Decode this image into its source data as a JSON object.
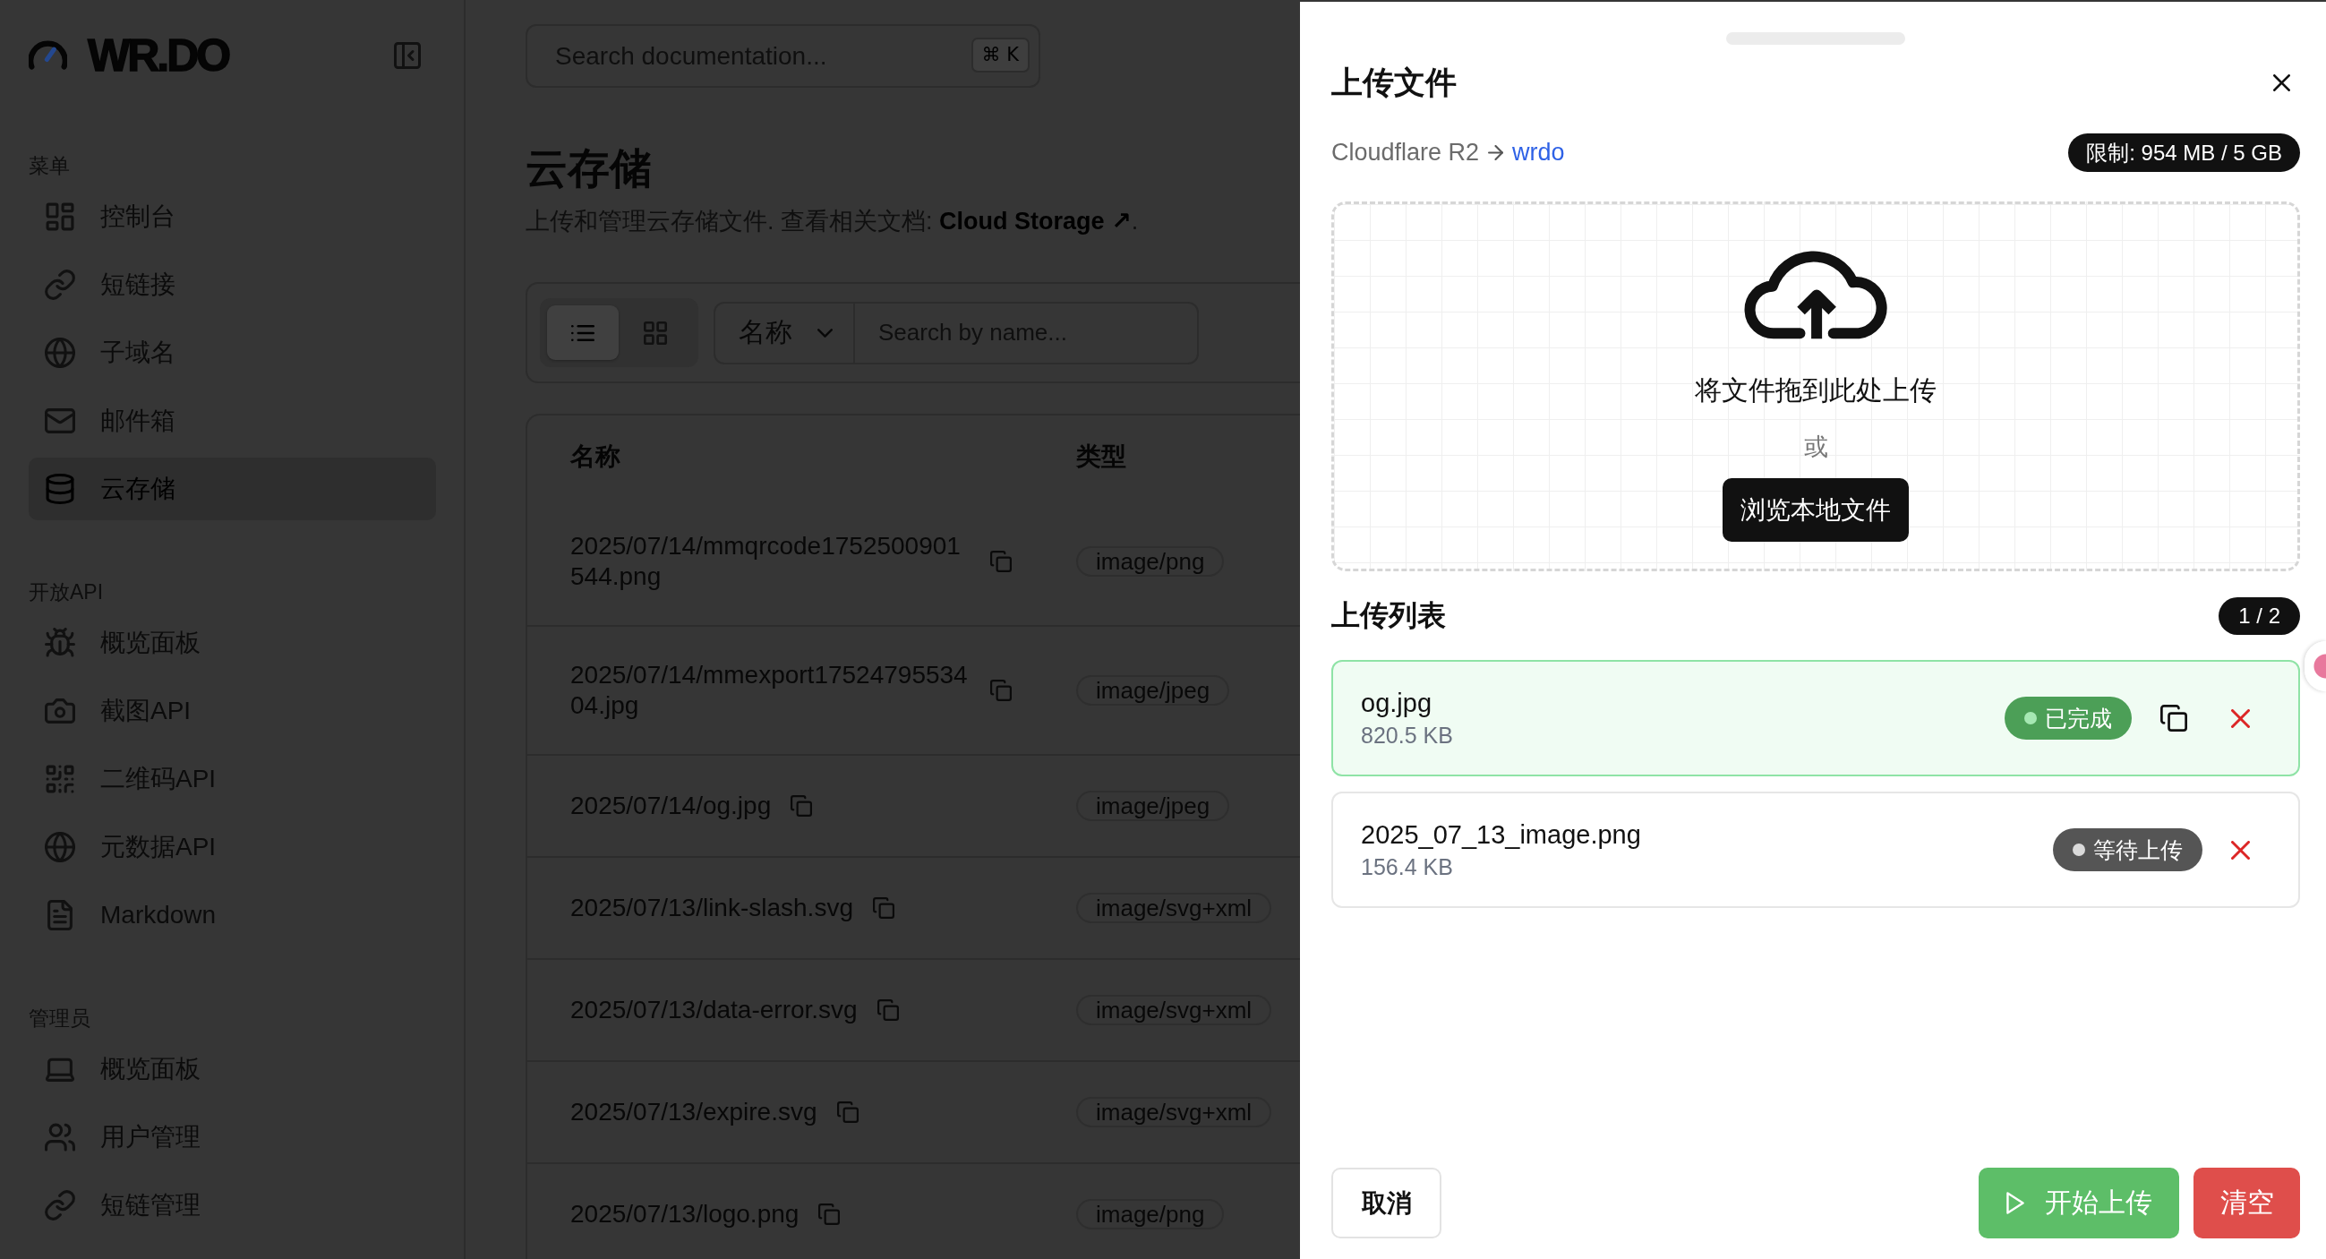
{
  "sidebar": {
    "logo": "WR.DO",
    "sections": [
      {
        "title": "菜单",
        "items": [
          {
            "label": "控制台",
            "selected": false
          },
          {
            "label": "短链接",
            "selected": false
          },
          {
            "label": "子域名",
            "selected": false
          },
          {
            "label": "邮件箱",
            "selected": false
          },
          {
            "label": "云存储",
            "selected": true
          }
        ]
      },
      {
        "title": "开放API",
        "items": [
          {
            "label": "概览面板",
            "selected": false
          },
          {
            "label": "截图API",
            "selected": false
          },
          {
            "label": "二维码API",
            "selected": false
          },
          {
            "label": "元数据API",
            "selected": false
          },
          {
            "label": "Markdown",
            "selected": false
          }
        ]
      },
      {
        "title": "管理员",
        "items": [
          {
            "label": "概览面板",
            "selected": false
          },
          {
            "label": "用户管理",
            "selected": false
          },
          {
            "label": "短链管理",
            "selected": false
          }
        ]
      }
    ]
  },
  "search": {
    "placeholder": "Search documentation...",
    "shortcut": "⌘ K"
  },
  "header": {
    "title": "云存储",
    "description": "上传和管理云存储文件. 查看相关文档:",
    "link": "Cloud Storage ↗",
    "description_end": "."
  },
  "toolbar": {
    "views": [
      {
        "kind": "list",
        "selected": true
      },
      {
        "kind": "grid",
        "selected": false
      }
    ],
    "sort": "名称",
    "search_placeholder": "Search by name..."
  },
  "table": {
    "columns": [
      "名称",
      "类型"
    ],
    "rows": [
      {
        "name": "2025/07/14/mmqrcode1752500901544.png",
        "type": "image/png"
      },
      {
        "name": "2025/07/14/mmexport1752479553404.jpg",
        "type": "image/jpeg"
      },
      {
        "name": "2025/07/14/og.jpg",
        "type": "image/jpeg"
      },
      {
        "name": "2025/07/13/link-slash.svg",
        "type": "image/svg+xml"
      },
      {
        "name": "2025/07/13/data-error.svg",
        "type": "image/svg+xml"
      },
      {
        "name": "2025/07/13/expire.svg",
        "type": "image/svg+xml"
      },
      {
        "name": "2025/07/13/logo.png",
        "type": "image/png"
      }
    ]
  },
  "upload_drawer": {
    "title": "上传文件",
    "provider": "Cloudflare R2",
    "bucket": "wrdo",
    "limit": "限制: 954 MB / 5 GB",
    "dropzone": {
      "prompt": "将文件拖到此处上传",
      "separator": "或",
      "browse_button": "浏览本地文件"
    },
    "list_title": "上传列表",
    "list_count": "1 / 2",
    "files": [
      {
        "name": "og.jpg",
        "size": "820.5 KB",
        "status": "已完成",
        "kind": "done"
      },
      {
        "name": "2025_07_13_image.png",
        "size": "156.4 KB",
        "status": "等待上传",
        "kind": "pending"
      }
    ],
    "buttons": {
      "cancel": "取消",
      "start": "开始上传",
      "clear": "清空"
    }
  }
}
